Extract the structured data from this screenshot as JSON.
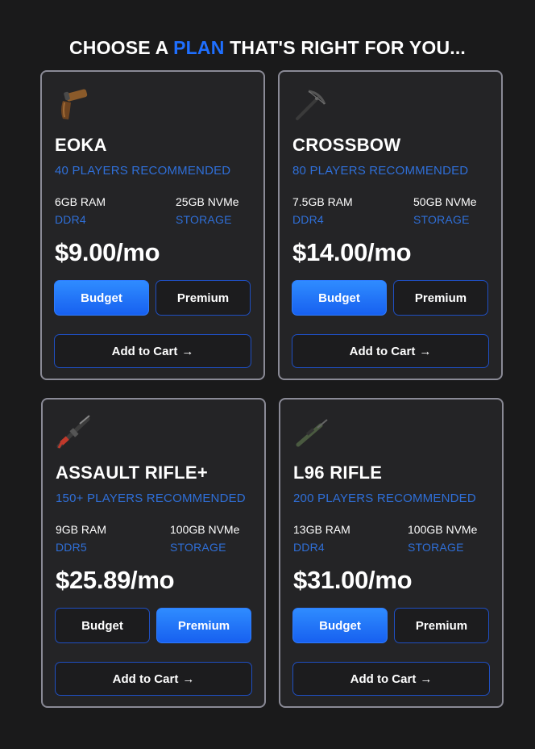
{
  "heading": {
    "prefix": "CHOOSE A",
    "accent": "PLAN",
    "suffix": "THAT'S RIGHT FOR YOU..."
  },
  "plans": [
    {
      "name": "EOKA",
      "recommended": "40 PLAYERS RECOMMENDED",
      "ram_value": "6GB RAM",
      "ram_type": "DDR4",
      "storage_value": "25GB NVMe",
      "storage_label": "STORAGE",
      "price": "$9.00/mo",
      "budget_label": "Budget",
      "premium_label": "Premium",
      "selected": "budget",
      "cart_label": "Add to Cart",
      "icon": "eoka-pistol-icon"
    },
    {
      "name": "CROSSBOW",
      "recommended": "80 PLAYERS RECOMMENDED",
      "ram_value": "7.5GB RAM",
      "ram_type": "DDR4",
      "storage_value": "50GB NVMe",
      "storage_label": "STORAGE",
      "price": "$14.00/mo",
      "budget_label": "Budget",
      "premium_label": "Premium",
      "selected": "budget",
      "cart_label": "Add to Cart",
      "icon": "crossbow-icon"
    },
    {
      "name": "ASSAULT RIFLE+",
      "recommended": "150+ PLAYERS RECOMMENDED",
      "ram_value": "9GB RAM",
      "ram_type": "DDR5",
      "storage_value": "100GB NVMe",
      "storage_label": "STORAGE",
      "price": "$25.89/mo",
      "budget_label": "Budget",
      "premium_label": "Premium",
      "selected": "premium",
      "cart_label": "Add to Cart",
      "icon": "assault-rifle-icon"
    },
    {
      "name": "L96 RIFLE",
      "recommended": "200 PLAYERS RECOMMENDED",
      "ram_value": "13GB RAM",
      "ram_type": "DDR4",
      "storage_value": "100GB NVMe",
      "storage_label": "STORAGE",
      "price": "$31.00/mo",
      "budget_label": "Budget",
      "premium_label": "Premium",
      "selected": "budget",
      "cart_label": "Add to Cart",
      "icon": "sniper-rifle-icon"
    }
  ],
  "colors": {
    "accent": "#1f6fff",
    "card_bg": "#242426",
    "page_bg": "#1a1a1b",
    "muted_blue": "#2f6fd8"
  },
  "arrow_glyph": "→"
}
